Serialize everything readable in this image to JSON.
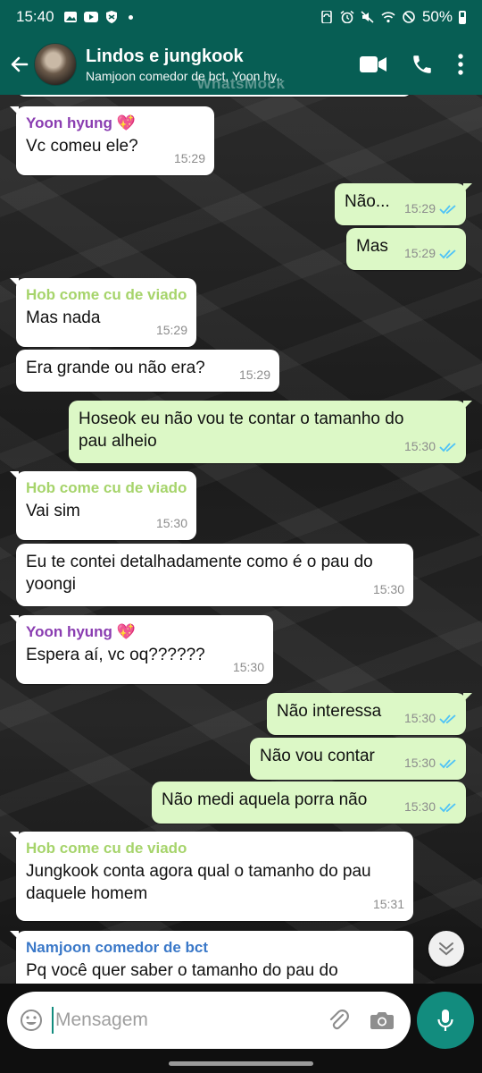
{
  "status_bar": {
    "time": "15:40",
    "battery": "50%"
  },
  "header": {
    "title": "Lindos e jungkook",
    "subtitle": "Namjoon comedor de bct, Yoon hy..",
    "watermark": "WhatsMock"
  },
  "messages": [
    {
      "dir": "in",
      "sender": "Yoon hyung 💖",
      "text": "Vc comeu ele?",
      "time": "15:29"
    },
    {
      "dir": "out",
      "text": "Não...",
      "time": "15:29",
      "status": "read"
    },
    {
      "dir": "out",
      "text": "Mas",
      "time": "15:29",
      "status": "read"
    },
    {
      "dir": "in",
      "sender": "Hob come cu de viado",
      "text": "Mas nada",
      "time": "15:29"
    },
    {
      "dir": "in",
      "text": "Era grande ou não era?",
      "time": "15:29"
    },
    {
      "dir": "out",
      "text": "Hoseok eu não vou te contar o tamanho do pau alheio",
      "time": "15:30",
      "status": "read"
    },
    {
      "dir": "in",
      "sender": "Hob come cu de viado",
      "text": "Vai sim",
      "time": "15:30"
    },
    {
      "dir": "in",
      "text": "Eu te contei detalhadamente como é o pau do yoongi",
      "time": "15:30"
    },
    {
      "dir": "in",
      "sender": "Yoon hyung 💖",
      "text": "Espera aí, vc oq??????",
      "time": "15:30"
    },
    {
      "dir": "out",
      "text": "Não interessa",
      "time": "15:30",
      "status": "read"
    },
    {
      "dir": "out",
      "text": "Não vou contar",
      "time": "15:30",
      "status": "read"
    },
    {
      "dir": "out",
      "text": "Não medi aquela porra não",
      "time": "15:30",
      "status": "read"
    },
    {
      "dir": "in",
      "sender": "Hob come cu de viado",
      "text": "Jungkook conta agora qual o tamanho do pau daquele homem",
      "time": "15:31"
    },
    {
      "dir": "in",
      "sender": "Namjoon comedor de bct",
      "text": "Pq você quer saber o tamanho do pau do",
      "time": ""
    }
  ],
  "input": {
    "placeholder": "Mensagem"
  },
  "icons": {
    "status_left": [
      "gallery-icon",
      "youtube-icon",
      "shield-icon",
      "dot-icon"
    ],
    "status_right": [
      "sync-icon",
      "alarm-icon",
      "mute-icon",
      "wifi-icon",
      "dnd-icon",
      "battery-icon"
    ],
    "header": [
      "back-arrow-icon",
      "video-call-icon",
      "phone-icon",
      "more-vert-icon"
    ],
    "input": [
      "emoji-icon",
      "attach-icon",
      "camera-icon",
      "mic-icon"
    ],
    "scroll": "chevron-double-down-icon"
  },
  "colors": {
    "header_bg": "#075e54",
    "outgoing_bubble": "#dcf8c6",
    "incoming_bubble": "#ffffff",
    "accent": "#128c7e",
    "read_ticks": "#4fc3f7",
    "sender_yoon": "#8a3db1",
    "sender_hob": "#a6d46b",
    "sender_namjoon": "#3a78c8"
  }
}
